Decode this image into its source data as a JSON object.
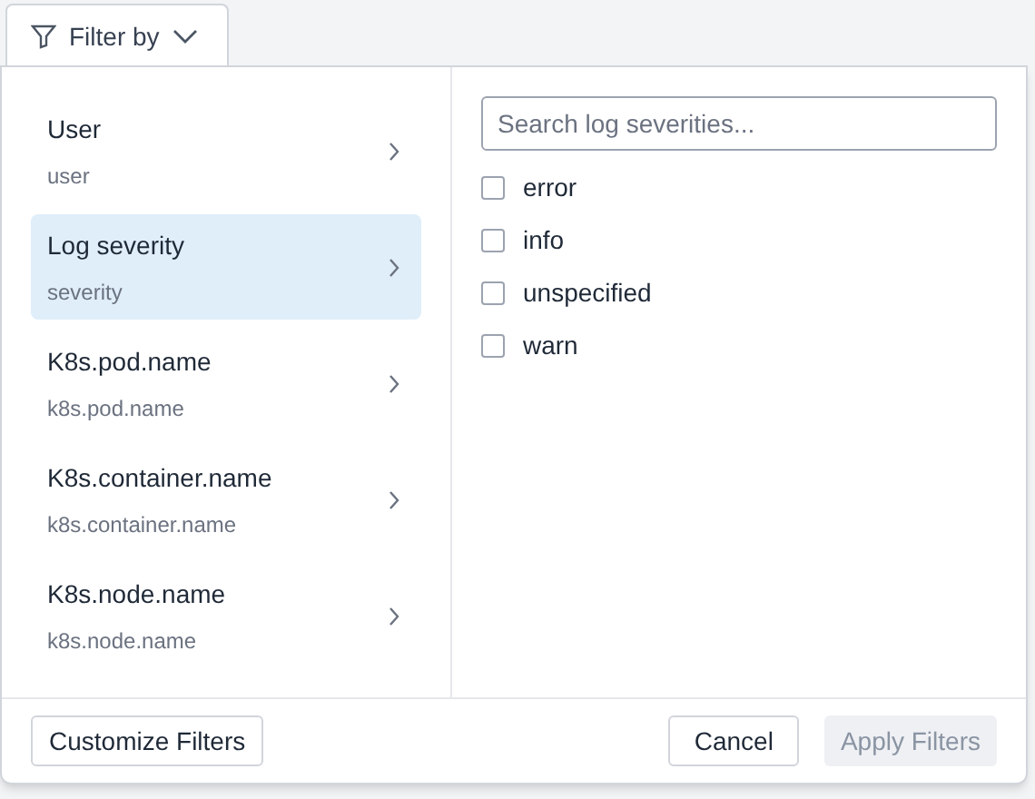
{
  "filter_button": {
    "label": "Filter by"
  },
  "fields": [
    {
      "label": "User",
      "key": "user",
      "selected": false
    },
    {
      "label": "Log severity",
      "key": "severity",
      "selected": true
    },
    {
      "label": "K8s.pod.name",
      "key": "k8s.pod.name",
      "selected": false
    },
    {
      "label": "K8s.container.name",
      "key": "k8s.container.name",
      "selected": false
    },
    {
      "label": "K8s.node.name",
      "key": "k8s.node.name",
      "selected": false
    }
  ],
  "search": {
    "placeholder": "Search log severities..."
  },
  "options": [
    {
      "label": "error",
      "checked": false
    },
    {
      "label": "info",
      "checked": false
    },
    {
      "label": "unspecified",
      "checked": false
    },
    {
      "label": "warn",
      "checked": false
    }
  ],
  "footer": {
    "customize": "Customize Filters",
    "cancel": "Cancel",
    "apply": {
      "label": "Apply Filters",
      "disabled": true
    }
  }
}
